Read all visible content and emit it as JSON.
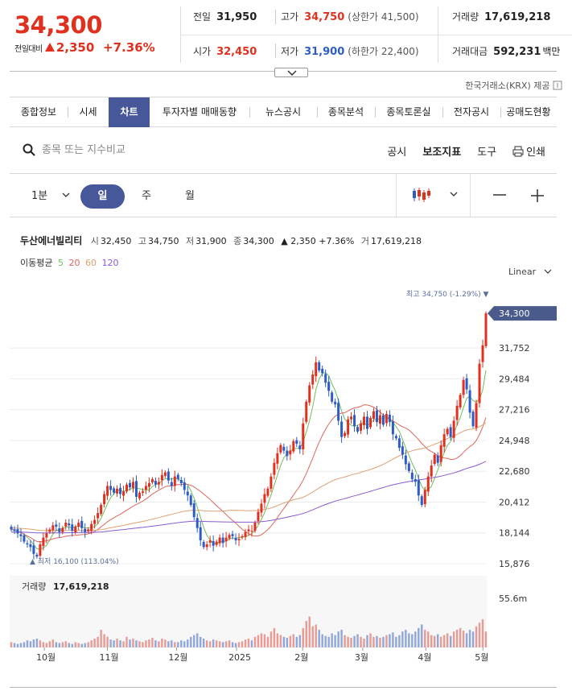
{
  "quote": {
    "price": "34,300",
    "change_label": "전일대비",
    "change_value": "2,350",
    "change_pct": "+7.36%",
    "prev_close_label": "전일",
    "prev_close": "31,950",
    "open_label": "시가",
    "open": "32,450",
    "high_label": "고가",
    "high": "34,750",
    "upper_limit": "(상한가 41,500)",
    "low_label": "저가",
    "low": "31,900",
    "lower_limit": "(하한가 22,400)",
    "volume_label": "거래량",
    "volume": "17,619,218",
    "amount_label": "거래대금",
    "amount": "592,231",
    "amount_unit": "백만",
    "colors": {
      "up": "#e0301e",
      "down": "#2d5cc7"
    }
  },
  "source_note": "한국거래소(KRX) 제공",
  "tabs": [
    "종합정보",
    "시세",
    "차트",
    "투자자별 매매동향",
    "뉴스공시",
    "종목분석",
    "종목토론실",
    "전자공시",
    "공매도현황"
  ],
  "active_tab": "차트",
  "search": {
    "placeholder": "종목 또는 지수비교"
  },
  "tools": {
    "disclosure": "공시",
    "indicators": "보조지표",
    "tool": "도구",
    "print": "인쇄"
  },
  "periods": {
    "minute": "1분",
    "day": "일",
    "week": "주",
    "month": "월"
  },
  "chart_header": {
    "name": "두산에너빌리티",
    "open_k": "시",
    "open_v": "32,450",
    "high_k": "고",
    "high_v": "34,750",
    "low_k": "저",
    "low_v": "31,900",
    "close_k": "종",
    "close_v": "34,300",
    "chg": "▲ 2,350 +7.36%",
    "vol_k": "거",
    "vol_v": "17,619,218",
    "ma_label": "이동평균",
    "ma_periods": [
      "5",
      "20",
      "60",
      "120"
    ],
    "ma_colors": [
      "#6fbf5a",
      "#e0665a",
      "#e0a070",
      "#8a5bd0"
    ]
  },
  "scale_label": "Linear",
  "chart_data": {
    "type": "candlestick",
    "y_ticks": [
      "34,300",
      "31,752",
      "29,484",
      "27,216",
      "24,948",
      "22,680",
      "20,412",
      "18,144",
      "15,876"
    ],
    "current_price": "34,300",
    "high_annotation": "최고 34,750 (-1.29%) ▼",
    "low_annotation": "▲ 최저 16,100 (113.04%)",
    "x_ticks": [
      "10월",
      "11월",
      "12월",
      "2025",
      "2월",
      "3월",
      "4월",
      "5월"
    ],
    "volume_label": "거래량",
    "volume_value": "17,619,218",
    "volume_max_label": "55.6m",
    "closes": [
      18400,
      18300,
      18100,
      17900,
      17500,
      17300,
      17100,
      16600,
      16400,
      17300,
      17800,
      18100,
      18400,
      18700,
      18600,
      18200,
      18500,
      18900,
      18700,
      18300,
      18600,
      18900,
      18500,
      18200,
      18400,
      18800,
      19100,
      19600,
      20200,
      21000,
      21600,
      21300,
      21100,
      21400,
      21000,
      21200,
      21700,
      21500,
      21900,
      20800,
      21100,
      21200,
      21600,
      21800,
      22100,
      21700,
      21900,
      22400,
      22600,
      22000,
      21600,
      22300,
      22100,
      21800,
      21300,
      20900,
      20200,
      19300,
      18500,
      17600,
      17100,
      17300,
      17600,
      17200,
      17500,
      17800,
      17400,
      17800,
      18000,
      17900,
      17600,
      17700,
      17900,
      18200,
      18400,
      18300,
      18900,
      19700,
      20300,
      21000,
      21400,
      22300,
      23300,
      24000,
      24600,
      24200,
      23800,
      24200,
      24900,
      24700,
      24300,
      26200,
      27800,
      29000,
      29800,
      30700,
      30100,
      29900,
      29200,
      28600,
      27800,
      27600,
      26400,
      25200,
      25500,
      26500,
      26700,
      26000,
      25600,
      26200,
      26700,
      25800,
      26600,
      27100,
      26300,
      26800,
      26100,
      26900,
      26300,
      25400,
      25100,
      24400,
      23900,
      23200,
      22700,
      22100,
      21900,
      20900,
      20200,
      21300,
      22300,
      23100,
      23900,
      23300,
      24600,
      25400,
      25800,
      25200,
      26400,
      27500,
      28300,
      29400,
      28700,
      27000,
      26000,
      27700,
      30600,
      31950,
      34300
    ],
    "volumes_m": [
      6,
      5,
      4,
      5,
      6,
      8,
      7,
      9,
      10,
      8,
      6,
      5,
      7,
      9,
      6,
      5,
      6,
      7,
      5,
      4,
      6,
      5,
      4,
      5,
      6,
      8,
      10,
      12,
      20,
      15,
      12,
      9,
      8,
      10,
      8,
      7,
      12,
      9,
      10,
      8,
      7,
      6,
      8,
      9,
      11,
      8,
      7,
      10,
      9,
      7,
      8,
      6,
      6,
      8,
      7,
      9,
      12,
      14,
      16,
      12,
      10,
      8,
      7,
      9,
      8,
      7,
      6,
      7,
      8,
      6,
      5,
      6,
      7,
      9,
      10,
      8,
      12,
      14,
      16,
      15,
      12,
      18,
      22,
      16,
      14,
      12,
      11,
      13,
      15,
      12,
      14,
      22,
      30,
      35,
      24,
      26,
      20,
      15,
      13,
      12,
      16,
      14,
      18,
      20,
      14,
      12,
      11,
      13,
      15,
      12,
      10,
      14,
      16,
      12,
      13,
      11,
      12,
      14,
      15,
      17,
      12,
      14,
      18,
      20,
      16,
      15,
      18,
      22,
      26,
      20,
      18,
      14,
      13,
      15,
      12,
      14,
      16,
      13,
      18,
      20,
      22,
      19,
      16,
      20,
      18,
      24,
      28,
      32,
      18
    ]
  }
}
